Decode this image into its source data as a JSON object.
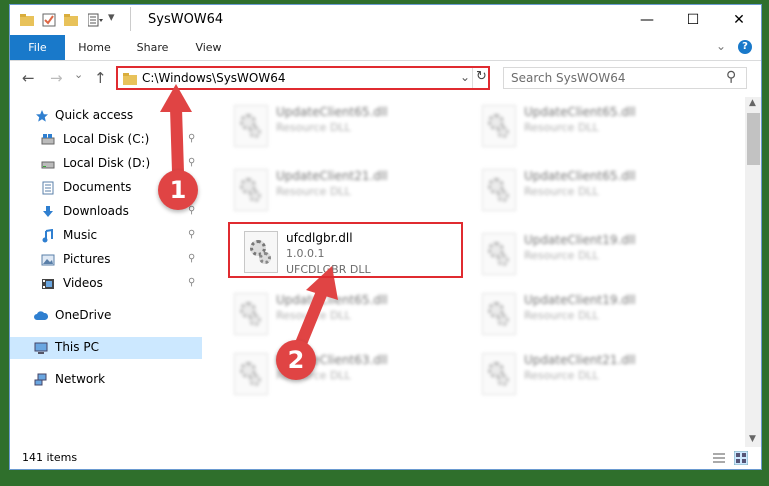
{
  "window": {
    "title": "SysWOW64",
    "minimize_glyph": "—",
    "maximize_glyph": "☐",
    "close_glyph": "✕"
  },
  "ribbon": {
    "tabs": [
      "File",
      "Home",
      "Share",
      "View"
    ],
    "help_glyph": "?",
    "expand_glyph": "⌄"
  },
  "nav": {
    "back_glyph": "←",
    "forward_glyph": "→",
    "recent_glyph": "⌄",
    "up_glyph": "↑",
    "address": "C:\\Windows\\SysWOW64",
    "address_dropdown_glyph": "⌄",
    "refresh_glyph": "↻",
    "search_placeholder": "Search SysWOW64",
    "search_glyph": "⚲"
  },
  "sidebar": {
    "items": [
      {
        "label": "Quick access",
        "icon": "star-icon",
        "pinned": false
      },
      {
        "label": "Local Disk (C:)",
        "icon": "drive-icon",
        "pinned": true
      },
      {
        "label": "Local Disk (D:)",
        "icon": "drive-icon",
        "pinned": true
      },
      {
        "label": "Documents",
        "icon": "documents-icon",
        "pinned": true
      },
      {
        "label": "Downloads",
        "icon": "downloads-icon",
        "pinned": true
      },
      {
        "label": "Music",
        "icon": "music-icon",
        "pinned": true
      },
      {
        "label": "Pictures",
        "icon": "pictures-icon",
        "pinned": true
      },
      {
        "label": "Videos",
        "icon": "videos-icon",
        "pinned": true
      },
      {
        "label": "OneDrive",
        "icon": "cloud-icon",
        "pinned": false
      },
      {
        "label": "This PC",
        "icon": "pc-icon",
        "pinned": false
      },
      {
        "label": "Network",
        "icon": "network-icon",
        "pinned": false
      }
    ],
    "pin_glyph": "📌"
  },
  "files": [
    {
      "name": "UpdateClient65.dll",
      "desc": "Resource DLL",
      "blurred": true
    },
    {
      "name": "UpdateClient65.dll",
      "desc": "Resource DLL",
      "blurred": true
    },
    {
      "name": "UpdateClient21.dll",
      "desc": "Resource DLL",
      "blurred": true
    },
    {
      "name": "UpdateClient65.dll",
      "desc": "Resource DLL",
      "blurred": true
    },
    {
      "name": "ufcdlgbr.dll",
      "desc": "1.0.0.1",
      "desc2": "UFCDLGBR DLL",
      "blurred": false
    },
    {
      "name": "UpdateClient19.dll",
      "desc": "Resource DLL",
      "blurred": true
    },
    {
      "name": "UpdateClient65.dll",
      "desc": "Resource DLL",
      "blurred": true
    },
    {
      "name": "UpdateClient19.dll",
      "desc": "Resource DLL",
      "blurred": true
    },
    {
      "name": "UpdateClient63.dll",
      "desc": "Resource DLL",
      "blurred": true
    },
    {
      "name": "UpdateClient21.dll",
      "desc": "Resource DLL",
      "blurred": true
    }
  ],
  "status": {
    "item_count": "141 items"
  },
  "annotations": {
    "step1": "1",
    "step2": "2",
    "color": "#e04444"
  },
  "colors": {
    "file_tab": "#1979ca",
    "highlight": "#e02b30",
    "selected_side": "#cce8ff"
  }
}
